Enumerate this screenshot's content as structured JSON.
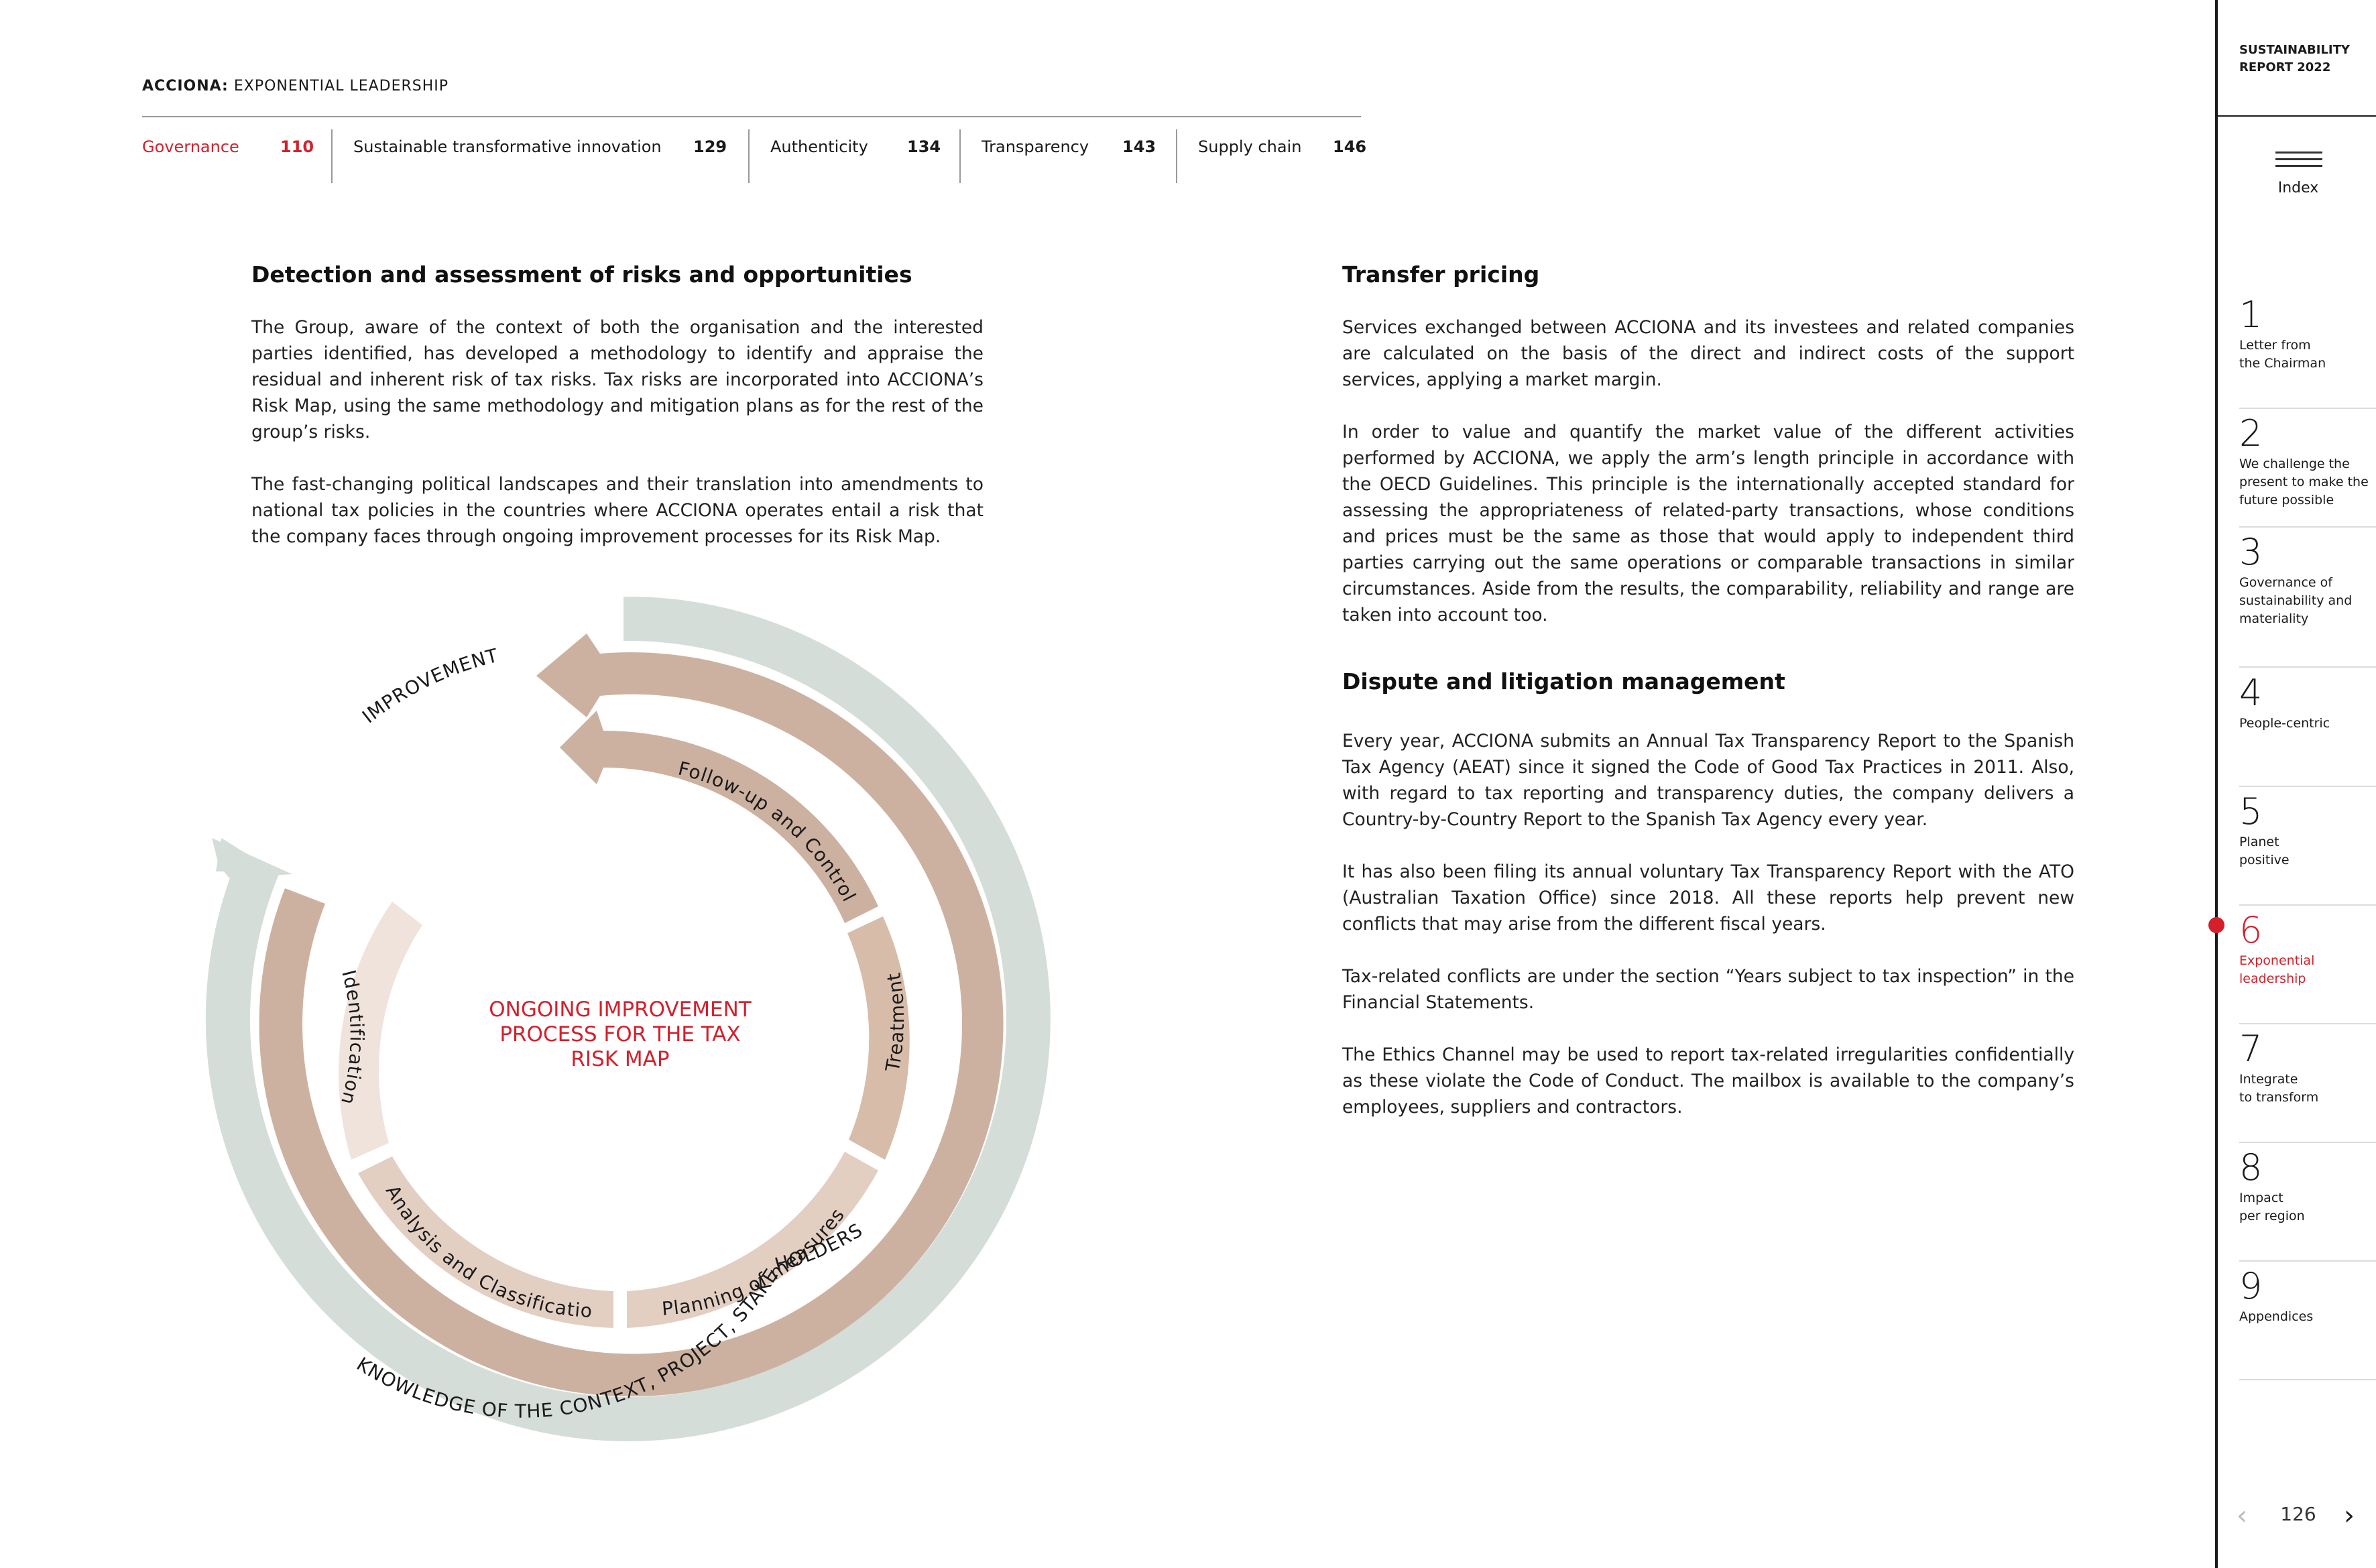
{
  "header": {
    "brand_bold": "ACCIONA:",
    "brand_rest": " EXPONENTIAL LEADERSHIP",
    "tabs": [
      {
        "label": "Governance",
        "page": "110"
      },
      {
        "label": "Sustainable transformative innovation",
        "page": "129"
      },
      {
        "label": "Authenticity",
        "page": "134"
      },
      {
        "label": "Transparency",
        "page": "143"
      },
      {
        "label": "Supply chain",
        "page": "146"
      }
    ]
  },
  "left": {
    "heading": "Detection and assessment of risks and opportunities",
    "p1": "The Group, aware of the context of both the organisation and the interested parties identified, has developed a methodology to identify and appraise the residual and inherent risk of tax risks. Tax risks are incorporated into ACCIONA’s Risk Map, using the same methodology and mitigation plans as for the rest of the group’s risks.",
    "p2": "The fast-changing political landscapes and their translation into amendments to national tax policies in the countries where ACCIONA operates entail a risk that the company faces through ongoing improvement processes for its Risk Map."
  },
  "diagram": {
    "outer_label": "IMPROVEMENT",
    "middle_label": "KNOWLEDGE OF THE CONTEXT, PROJECT, STAKEHOLDERS",
    "segments": [
      "Follow-up and Control",
      "Treatment",
      "Planning of measures",
      "Analysis and Classification",
      "Identification"
    ],
    "center_line1": "ONGOING IMPROVEMENT",
    "center_line2": "PROCESS FOR THE TAX",
    "center_line3": "RISK MAP",
    "colors": {
      "outer": "#d5ddd8",
      "middle": "#cdb1a0",
      "inner_dark": "#d7bca9",
      "inner_mid": "#e3cfc2",
      "inner_light": "#efe3dc",
      "accent": "#d4202c"
    }
  },
  "right": {
    "heading1": "Transfer pricing",
    "p1": "Services exchanged between ACCIONA and its investees and related companies are calculated on the basis of the direct and indirect costs of the support services, applying a market margin.",
    "p2": "In order to value and quantify the market value of the different activities performed by ACCIONA, we apply the arm’s length principle in accordance with the OECD Guidelines. This principle is the internationally accepted standard for assessing the appropriateness of related-party transactions, whose conditions and prices must be the same as those that would apply to independent third parties carrying out the same operations or comparable transactions in similar circumstances. Aside from the results, the comparability, reliability and range are taken into account too.",
    "heading2": "Dispute and litigation management",
    "p3": "Every year, ACCIONA submits an Annual Tax Transparency Report to the Spanish Tax Agency (AEAT) since it signed the Code of Good Tax Practices in 2011. Also, with regard to tax reporting and transparency duties, the company delivers a Country-by-Country Report to the Spanish Tax Agency every year.",
    "p4": "It has also been filing its annual voluntary Tax Transparency Report with the ATO (Australian Taxation Office) since 2018. All these reports help prevent new conflicts that may arise from the different fiscal years.",
    "p5": "Tax-related conflicts are under the section “Years subject to tax inspection” in the Financial Statements.",
    "p6": "The Ethics Channel may be used to report tax-related irregularities confidentially as these violate the Code of Conduct. The mailbox is available to the company’s employees, suppliers and contractors."
  },
  "sidebar": {
    "report_line1": "SUSTAINABILITY",
    "report_line2": "REPORT 2022",
    "index_label": "Index",
    "chapters": [
      {
        "num": "1",
        "l1": "Letter from",
        "l2": "the Chairman",
        "l3": ""
      },
      {
        "num": "2",
        "l1": "We challenge the",
        "l2": "present to make the",
        "l3": "future possible"
      },
      {
        "num": "3",
        "l1": "Governance of",
        "l2": "sustainability and",
        "l3": "materiality"
      },
      {
        "num": "4",
        "l1": "People-centric",
        "l2": "",
        "l3": ""
      },
      {
        "num": "5",
        "l1": "Planet",
        "l2": "positive",
        "l3": ""
      },
      {
        "num": "6",
        "l1": "Exponential",
        "l2": "leadership",
        "l3": ""
      },
      {
        "num": "7",
        "l1": "Integrate",
        "l2": "to transform",
        "l3": ""
      },
      {
        "num": "8",
        "l1": "Impact",
        "l2": "per region",
        "l3": ""
      },
      {
        "num": "9",
        "l1": "Appendices",
        "l2": "",
        "l3": ""
      }
    ],
    "page_number": "126",
    "prev_icon": "‹",
    "next_icon": "›"
  }
}
